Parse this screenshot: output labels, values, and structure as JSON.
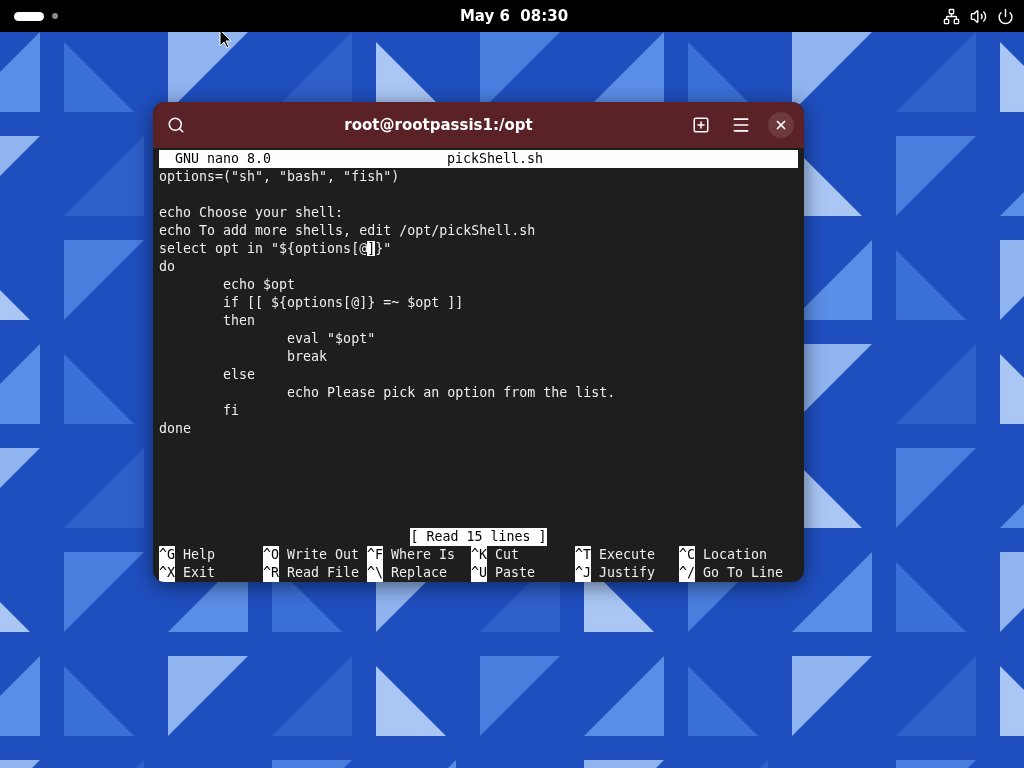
{
  "top_bar": {
    "clock": "May 6  08:30"
  },
  "terminal": {
    "title": "root@rootpassis1:/opt",
    "nano": {
      "version": "GNU nano 8.0",
      "filename": "pickShell.sh",
      "line_groups": [
        [
          {
            "text": "options=(\"sh\", \"bash\", \"fish\")"
          }
        ],
        [
          {
            "text": "echo Choose your shell:"
          },
          {
            "text": "echo To add more shells, edit /opt/pickShell.sh"
          },
          {
            "text": "select opt in \"${options[@",
            "cursor": "]",
            "rest": "}\""
          },
          {
            "text": "do"
          },
          {
            "text": "        echo $opt"
          },
          {
            "text": "        if [[ ${options[@]} =~ $opt ]]"
          },
          {
            "text": "        then"
          },
          {
            "text": "                eval \"$opt\""
          },
          {
            "text": "                break"
          },
          {
            "text": "        else"
          },
          {
            "text": "                echo Please pick an option from the list."
          },
          {
            "text": "        fi"
          },
          {
            "text": "done"
          }
        ]
      ],
      "status": "[ Read 15 lines ]",
      "shortcuts": [
        [
          {
            "key": "^G",
            "label": "Help"
          },
          {
            "key": "^X",
            "label": "Exit"
          }
        ],
        [
          {
            "key": "^O",
            "label": "Write Out"
          },
          {
            "key": "^R",
            "label": "Read File"
          }
        ],
        [
          {
            "key": "^F",
            "label": "Where Is"
          },
          {
            "key": "^\\",
            "label": "Replace"
          }
        ],
        [
          {
            "key": "^K",
            "label": "Cut"
          },
          {
            "key": "^U",
            "label": "Paste"
          }
        ],
        [
          {
            "key": "^T",
            "label": "Execute"
          },
          {
            "key": "^J",
            "label": "Justify"
          }
        ],
        [
          {
            "key": "^C",
            "label": "Location"
          },
          {
            "key": "^/",
            "label": "Go To Line"
          }
        ]
      ]
    }
  }
}
